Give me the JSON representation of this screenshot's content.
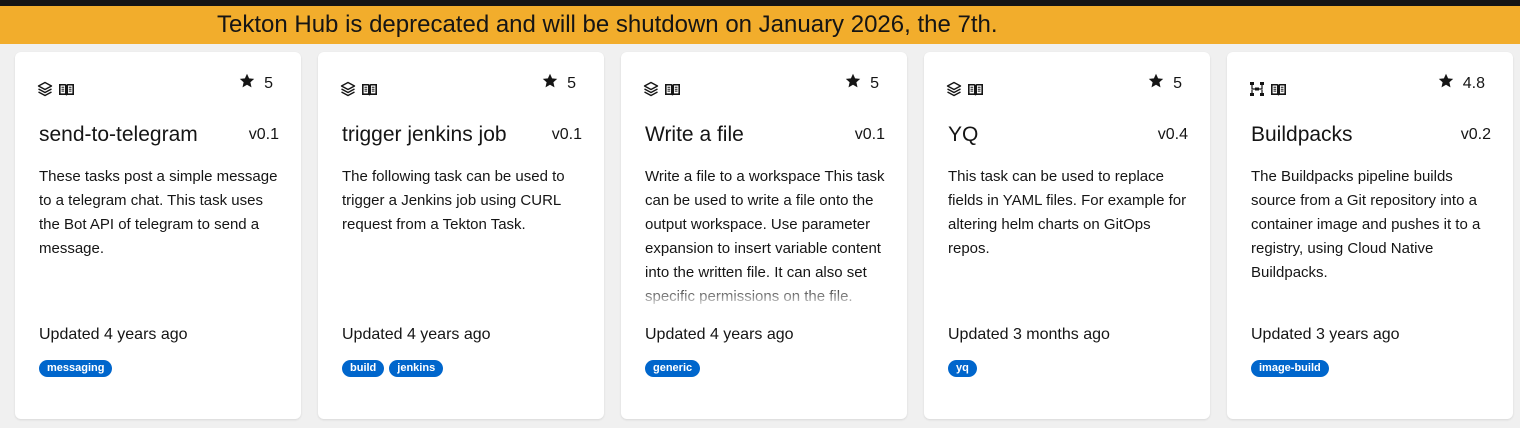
{
  "banner": {
    "text": "Tekton Hub is deprecated and will be shutdown on January 2026, the 7th."
  },
  "cards": [
    {
      "kind_icon": "layers-icon",
      "catalog_icon": "book-icon",
      "rating": "5",
      "title": "send-to-telegram",
      "version": "v0.1",
      "description": "These tasks post a simple message to a telegram chat. This task uses the Bot API of telegram to send a message.",
      "updated": "Updated 4 years ago",
      "tags": [
        "messaging"
      ]
    },
    {
      "kind_icon": "layers-icon",
      "catalog_icon": "book-icon",
      "rating": "5",
      "title": "trigger jenkins job",
      "version": "v0.1",
      "description": "The following task can be used to trigger a Jenkins job using CURL request from a Tekton Task.",
      "updated": "Updated 4 years ago",
      "tags": [
        "build",
        "jenkins"
      ]
    },
    {
      "kind_icon": "layers-icon",
      "catalog_icon": "book-icon",
      "rating": "5",
      "title": "Write a file",
      "version": "v0.1",
      "description": "Write a file to a workspace This task can be used to write a file onto the output workspace. Use parameter expansion to insert variable content into the written file. It can also set specific permissions on the file.",
      "updated": "Updated 4 years ago",
      "tags": [
        "generic"
      ]
    },
    {
      "kind_icon": "layers-icon",
      "catalog_icon": "book-icon",
      "rating": "5",
      "title": "YQ",
      "version": "v0.4",
      "description": "This task can be used to replace fields in YAML files. For example for altering helm charts on GitOps repos.",
      "updated": "Updated 3 months ago",
      "tags": [
        "yq"
      ]
    },
    {
      "kind_icon": "pipeline-icon",
      "catalog_icon": "book-icon",
      "rating": "4.8",
      "title": "Buildpacks",
      "version": "v0.2",
      "description": "The Buildpacks pipeline builds source from a Git repository into a container image and pushes it to a registry, using Cloud Native Buildpacks.",
      "updated": "Updated 3 years ago",
      "tags": [
        "image-build"
      ]
    }
  ],
  "colors": {
    "banner": "#f2ad2c",
    "tag": "#0066cc",
    "background": "#f0f0f0",
    "card": "#ffffff"
  }
}
